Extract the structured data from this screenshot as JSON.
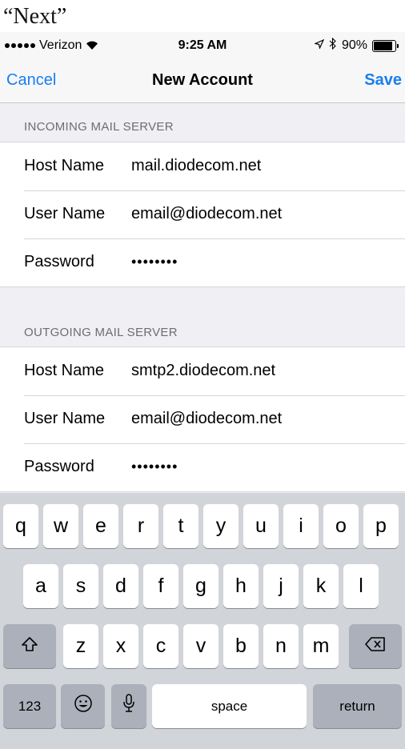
{
  "caption": "“Next”",
  "status_bar": {
    "carrier": "Verizon",
    "time": "9:25 AM",
    "battery": "90%",
    "battery_level": 0.9,
    "icons": [
      "signal-dots-icon",
      "wifi-icon",
      "location-arrow-icon",
      "bluetooth-icon",
      "battery-icon"
    ]
  },
  "nav": {
    "cancel": "Cancel",
    "title": "New Account",
    "save": "Save",
    "accent_color": "#1a7ef0"
  },
  "incoming": {
    "header": "INCOMING MAIL SERVER",
    "rows": [
      {
        "label": "Host Name",
        "value": "mail.diodecom.net"
      },
      {
        "label": "User Name",
        "value": "email@diodecom.net"
      },
      {
        "label": "Password",
        "value": "••••••••"
      }
    ]
  },
  "outgoing": {
    "header": "OUTGOING MAIL SERVER",
    "rows": [
      {
        "label": "Host Name",
        "value": "smtp2.diodecom.net"
      },
      {
        "label": "User Name",
        "value": "email@diodecom.net"
      },
      {
        "label": "Password",
        "value": "••••••••"
      }
    ]
  },
  "keyboard": {
    "row1": [
      "q",
      "w",
      "e",
      "r",
      "t",
      "y",
      "u",
      "i",
      "o",
      "p"
    ],
    "row2": [
      "a",
      "s",
      "d",
      "f",
      "g",
      "h",
      "j",
      "k",
      "l"
    ],
    "row3": [
      "z",
      "x",
      "c",
      "v",
      "b",
      "n",
      "m"
    ],
    "shift_icon": "shift-icon",
    "delete_icon": "delete-icon",
    "numbers": "123",
    "emoji_icon": "emoji-icon",
    "mic_icon": "microphone-icon",
    "space": "space",
    "return": "return"
  }
}
